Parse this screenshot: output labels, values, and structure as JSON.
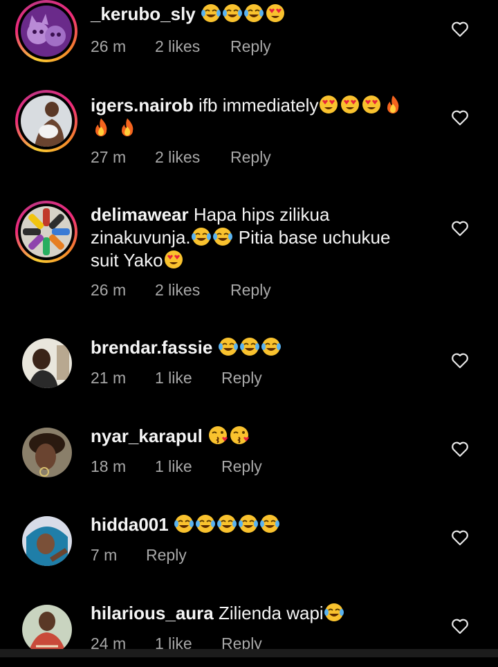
{
  "comments": [
    {
      "username": "_kerubo_sly",
      "text": "",
      "emojis": [
        "laugh-cry",
        "laugh-cry",
        "laugh-cry",
        "heart-eyes"
      ],
      "emojis_line2": [],
      "time": "26 m",
      "likes": "2 likes",
      "reply": "Reply",
      "ring": true,
      "avatar": "purple-cat"
    },
    {
      "username": "igers.nairob",
      "text": " ifb immediately",
      "emojis": [
        "heart-eyes",
        "heart-eyes",
        "heart-eyes",
        "fire"
      ],
      "emojis_line2": [
        "fire",
        "fire"
      ],
      "time": "27 m",
      "likes": "2 likes",
      "reply": "Reply",
      "ring": true,
      "avatar": "woman-pose"
    },
    {
      "username": "delimawear",
      "text_line1": " Hapa hips zilikua",
      "text_line2": "zinakuvunja.",
      "text_line2_after": " Pitia base uchukue",
      "text_line3": "suit Yako",
      "time": "26 m",
      "likes": "2 likes",
      "reply": "Reply",
      "ring": true,
      "avatar": "shoes"
    },
    {
      "username": "brendar.fassie",
      "text": " ",
      "emojis": [
        "laugh-cry",
        "laugh-cry",
        "laugh-cry"
      ],
      "time": "21 m",
      "likes": "1 like",
      "reply": "Reply",
      "ring": false,
      "avatar": "selfie-1"
    },
    {
      "username": "nyar_karapul",
      "text": " ",
      "emojis": [
        "kiss",
        "kiss"
      ],
      "time": "18 m",
      "likes": "1 like",
      "reply": "Reply",
      "ring": false,
      "avatar": "selfie-2"
    },
    {
      "username": "hidda001",
      "text": " ",
      "emojis": [
        "laugh-cry",
        "laugh-cry",
        "laugh-cry",
        "laugh-cry",
        "laugh-cry"
      ],
      "time": "7 m",
      "likes": "",
      "reply": "Reply",
      "ring": false,
      "avatar": "selfie-3"
    },
    {
      "username": "hilarious_aura",
      "text": " Zilienda wapi",
      "emojis": [
        "laugh-cry"
      ],
      "time": "24 m",
      "likes": "1 like",
      "reply": "Reply",
      "ring": false,
      "avatar": "selfie-4"
    }
  ],
  "icons": {
    "like": "heart-outline-icon"
  },
  "colors": {
    "background": "#000000",
    "text": "#f5f5f5",
    "meta": "#a8a8a8",
    "ring_start": "#f9ce34",
    "ring_end": "#ee2a7b"
  }
}
